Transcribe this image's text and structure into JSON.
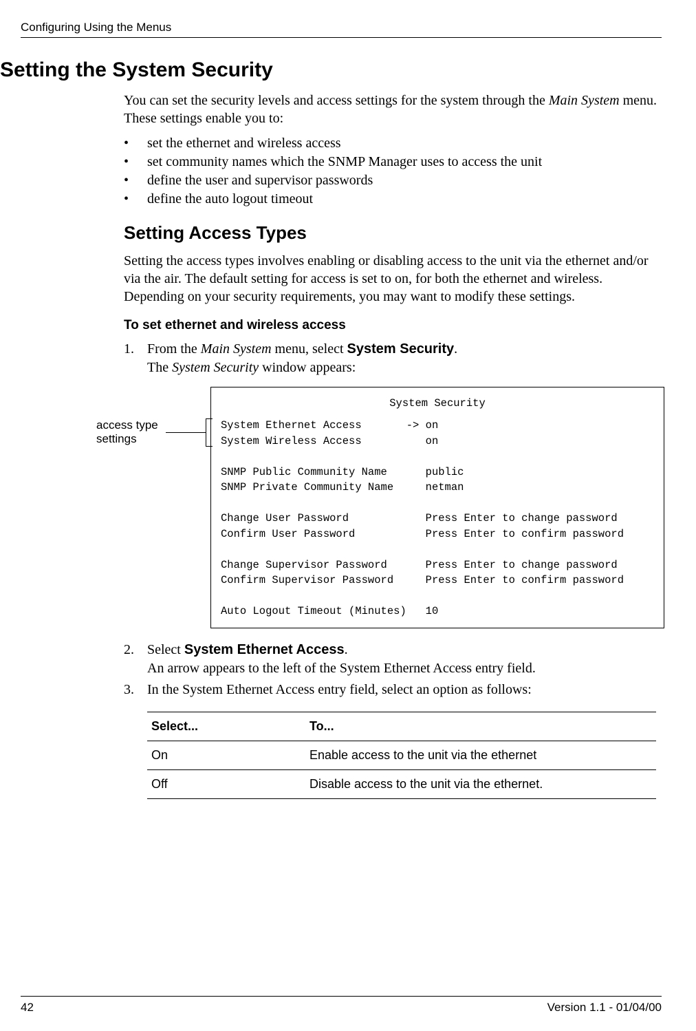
{
  "running_head": "Configuring Using the Menus",
  "h1": "Setting the System Security",
  "intro_a": "You can set the security levels and access settings for the system through the ",
  "intro_b_italic": "Main System",
  "intro_c": " menu. These settings enable you to:",
  "bullets": [
    "set the ethernet and wireless access",
    "set community names which the SNMP Manager uses to access the unit",
    "define the user and supervisor passwords",
    "define the auto logout timeout"
  ],
  "h2": "Setting Access Types",
  "para2": "Setting the access types involves enabling or disabling access to the unit via the ethernet and/or via the air. The default setting for access is set to on, for both the ethernet and wireless. Depending on your security requirements, you may want to modify these settings.",
  "h3": "To set ethernet and wireless access",
  "steps": {
    "s1": {
      "num": "1.",
      "a": "From the ",
      "b_italic": "Main System",
      "c": " menu, select ",
      "d_bold": "System Security",
      "e": ".",
      "sub_a": "The ",
      "sub_b_italic": "System Security",
      "sub_c": " window appears:"
    },
    "s2": {
      "num": "2.",
      "a": "Select ",
      "b_bold": "System Ethernet Access",
      "c": ".",
      "sub": "An arrow appears to the left of the System Ethernet Access entry field."
    },
    "s3": {
      "num": "3.",
      "text": "In the System Ethernet Access entry field, select an option as follows:"
    }
  },
  "callout": {
    "line1": "access type",
    "line2": "settings"
  },
  "terminal": {
    "title": "System Security",
    "rows": [
      {
        "label": "System Ethernet Access",
        "arrow": "->",
        "value": "on"
      },
      {
        "label": "System Wireless Access",
        "arrow": "",
        "value": "on"
      },
      {
        "label": "",
        "arrow": "",
        "value": ""
      },
      {
        "label": "SNMP Public Community Name",
        "arrow": "",
        "value": "public"
      },
      {
        "label": "SNMP Private Community Name",
        "arrow": "",
        "value": "netman"
      },
      {
        "label": "",
        "arrow": "",
        "value": ""
      },
      {
        "label": "Change User Password",
        "arrow": "",
        "value": "Press Enter to change password"
      },
      {
        "label": "Confirm User Password",
        "arrow": "",
        "value": "Press Enter to confirm password"
      },
      {
        "label": "",
        "arrow": "",
        "value": ""
      },
      {
        "label": "Change Supervisor Password",
        "arrow": "",
        "value": "Press Enter to change password"
      },
      {
        "label": "Confirm Supervisor Password",
        "arrow": "",
        "value": "Press Enter to confirm password"
      },
      {
        "label": "",
        "arrow": "",
        "value": ""
      },
      {
        "label": "Auto Logout Timeout (Minutes)",
        "arrow": "",
        "value": "10"
      }
    ]
  },
  "options_table": {
    "h1": "Select...",
    "h2": "To...",
    "rows": [
      {
        "opt": "On",
        "desc": "Enable access to the unit via the ethernet"
      },
      {
        "opt": "Off",
        "desc": "Disable access to the unit via the ethernet."
      }
    ]
  },
  "footer": {
    "page": "42",
    "version": "Version 1.1 - 01/04/00"
  }
}
